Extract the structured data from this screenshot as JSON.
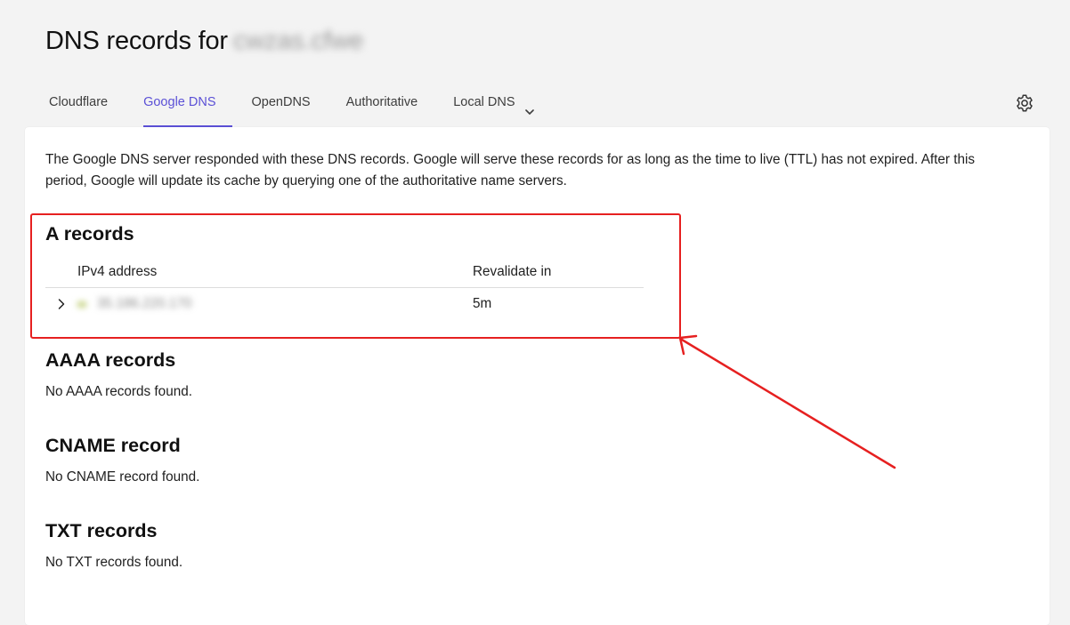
{
  "header": {
    "title_prefix": "DNS records for",
    "domain": "cwzas.cfwe"
  },
  "tabs": [
    {
      "label": "Cloudflare",
      "active": false
    },
    {
      "label": "Google DNS",
      "active": true
    },
    {
      "label": "OpenDNS",
      "active": false
    },
    {
      "label": "Authoritative",
      "active": false
    },
    {
      "label": "Local DNS",
      "active": false,
      "has_dropdown": true
    }
  ],
  "icons": {
    "settings": "gear-icon",
    "dropdown": "chevron-down-icon",
    "expand": "chevron-right-icon"
  },
  "colors": {
    "accent": "#5b50d6",
    "highlight": "#e62020"
  },
  "intro_text": "The Google DNS server responded with these DNS records. Google will serve these records for as long as the time to live (TTL) has not expired. After this period, Google will update its cache by querying one of the authoritative name servers.",
  "a_records": {
    "heading": "A records",
    "columns": [
      "IPv4 address",
      "Revalidate in"
    ],
    "rows": [
      {
        "ipv4": "35.186.220.170",
        "revalidate": "5m"
      }
    ]
  },
  "aaaa_records": {
    "heading": "AAAA records",
    "empty_text": "No AAAA records found."
  },
  "cname_record": {
    "heading": "CNAME record",
    "empty_text": "No CNAME record found."
  },
  "txt_records": {
    "heading": "TXT records",
    "empty_text": "No TXT records found."
  }
}
